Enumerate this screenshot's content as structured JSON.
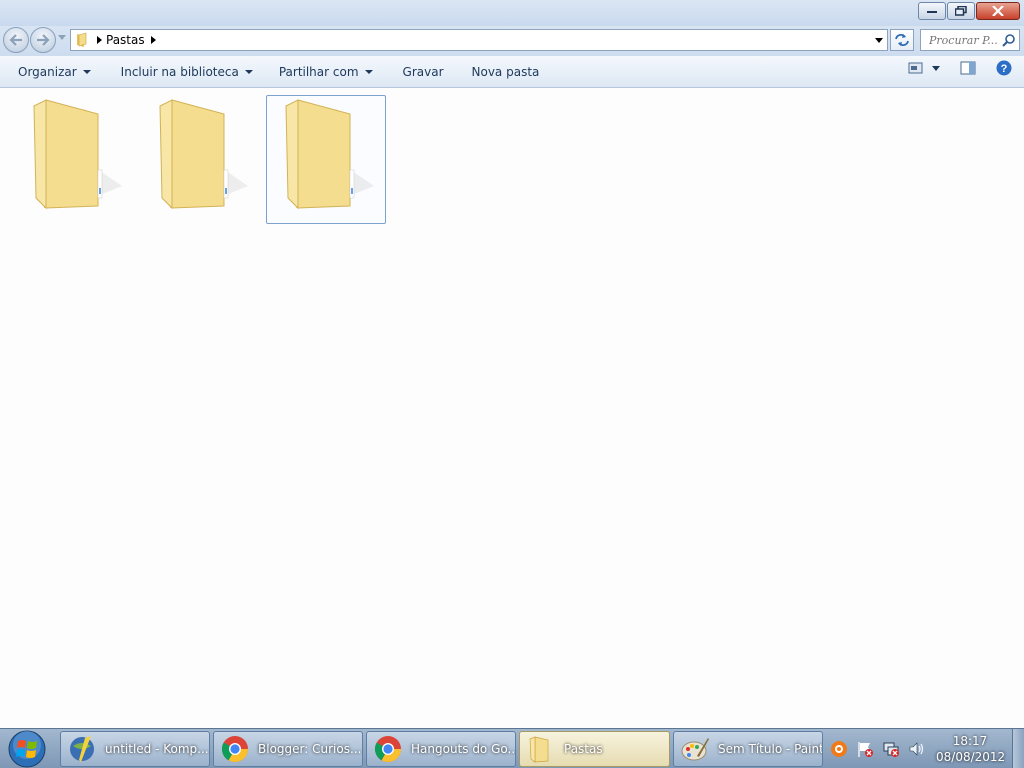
{
  "window": {
    "minimize_icon": "minimize-icon",
    "maximize_icon": "restore-icon",
    "close_icon": "close-icon"
  },
  "address": {
    "crumb": "Pastas",
    "search_placeholder": "Procurar P..."
  },
  "toolbar": {
    "organize": "Organizar",
    "include_library": "Incluir na biblioteca",
    "share_with": "Partilhar com",
    "burn": "Gravar",
    "new_folder": "Nova pasta"
  },
  "content": {
    "folders": [
      {
        "name": "",
        "selected": false
      },
      {
        "name": "",
        "selected": false
      },
      {
        "name": "",
        "selected": true
      }
    ]
  },
  "taskbar": {
    "buttons": [
      {
        "label": "untitled - Komp...",
        "icon": "kompozer-icon"
      },
      {
        "label": "Blogger: Curios...",
        "icon": "chrome-icon"
      },
      {
        "label": "Hangouts do Go...",
        "icon": "chrome-icon"
      },
      {
        "label": "Pastas",
        "icon": "folder-icon",
        "active": true
      },
      {
        "label": "Sem Título - Paint",
        "icon": "paint-icon"
      }
    ],
    "clock_time": "18:17",
    "clock_date": "08/08/2012"
  },
  "colors": {
    "accent": "#1e395b",
    "folder_yellow": "#f2d57c",
    "selection_border": "#7da2ce"
  }
}
